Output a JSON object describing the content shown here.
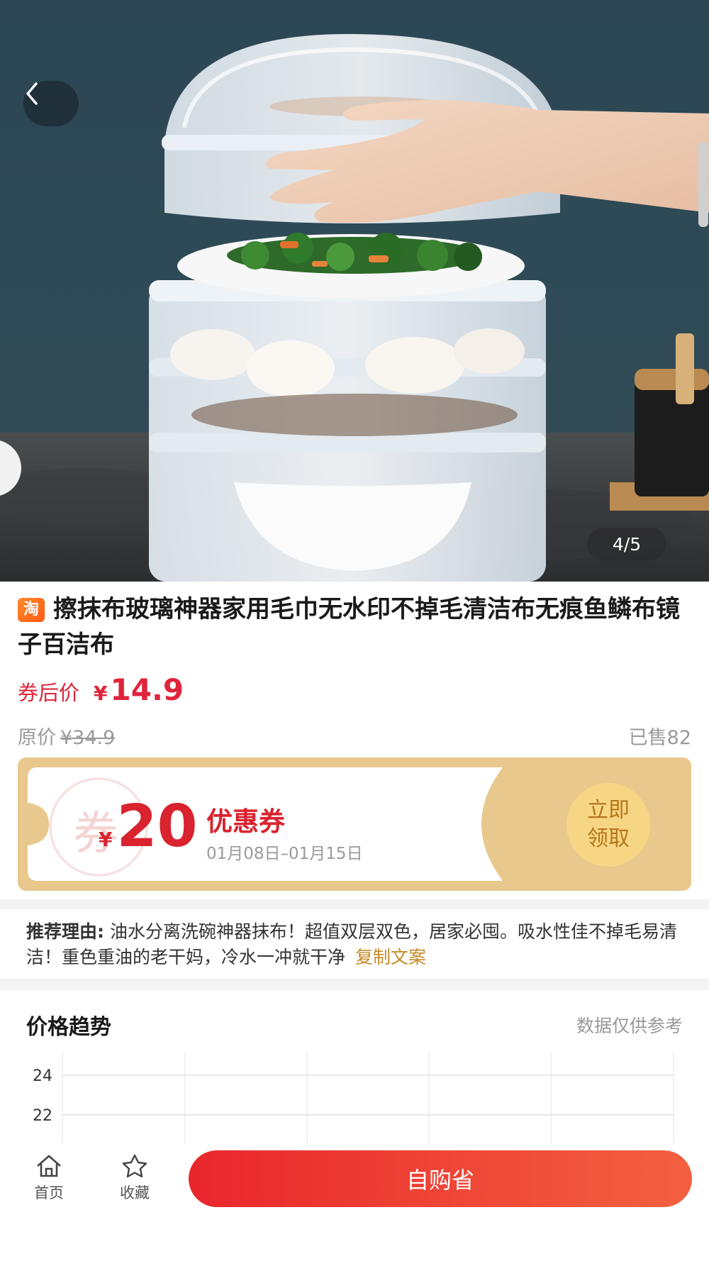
{
  "hero": {
    "image_counter": "4/5"
  },
  "product": {
    "platform_badge": "淘",
    "title": "擦抹布玻璃神器家用毛巾无水印不掉毛清洁布无痕鱼鳞布镜子百洁布",
    "coupon_price_label": "券后价",
    "currency": "¥",
    "coupon_price": "14.9",
    "original_price_label": "原价",
    "original_price": "¥34.9",
    "sold": "已售82"
  },
  "coupon": {
    "currency": "¥",
    "amount": "20",
    "title": "优惠券",
    "validity": "01月08日–01月15日",
    "claim_button": "立即\n领取",
    "claim_line1": "立即",
    "claim_line2": "领取",
    "stamp_char": "券"
  },
  "recommend": {
    "label": "推荐理由:",
    "text": "油水分离洗碗神器抹布！超值双层双色，居家必囤。吸水性佳不掉毛易清洁！重色重油的老干妈，冷水一冲就干净",
    "copy_link": "复制文案"
  },
  "price_trend": {
    "title": "价格趋势",
    "note": "数据仅供参考"
  },
  "chart_data": {
    "type": "line",
    "title": "价格趋势",
    "y_ticks": [
      "24",
      "22"
    ],
    "grid": true,
    "series": []
  },
  "bottom_nav": {
    "home_label": "首页",
    "favorite_label": "收藏",
    "buy_button": "自购省"
  },
  "colors": {
    "price_red": "#e0243b",
    "coupon_bg": "#e8c88c",
    "copy_link": "#c48a25",
    "buy_button": "#ee3a32"
  }
}
